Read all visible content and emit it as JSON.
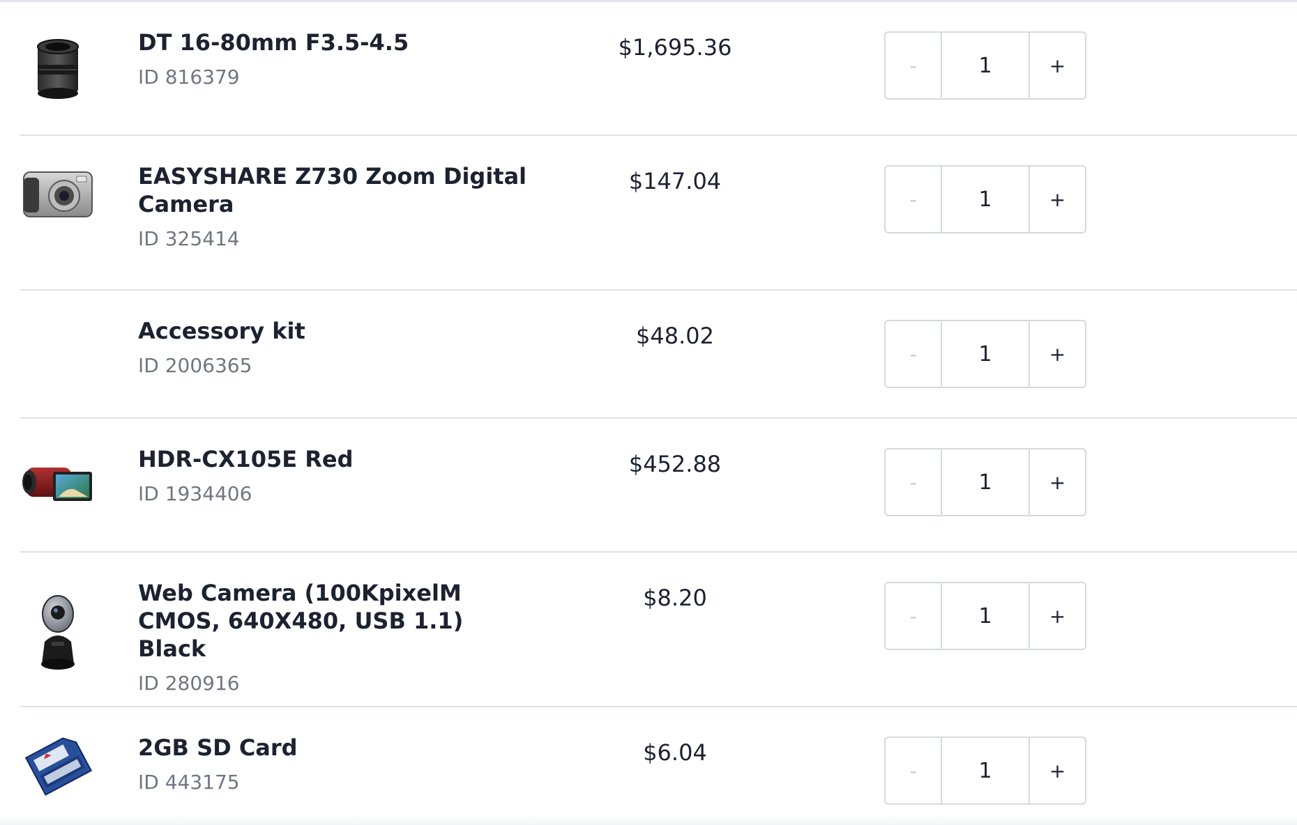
{
  "cart": {
    "items": [
      {
        "name": "DT 16-80mm F3.5-4.5",
        "id_text": "ID 816379",
        "price": "$1,695.36",
        "quantity": "1",
        "decrement_label": "-",
        "increment_label": "+",
        "image_icon": "camera-lens-icon"
      },
      {
        "name": "EASYSHARE Z730 Zoom Digital Camera",
        "id_text": "ID 325414",
        "price": "$147.04",
        "quantity": "1",
        "decrement_label": "-",
        "increment_label": "+",
        "image_icon": "digital-camera-icon"
      },
      {
        "name": "Accessory kit",
        "id_text": "ID 2006365",
        "price": "$48.02",
        "quantity": "1",
        "decrement_label": "-",
        "increment_label": "+",
        "image_icon": ""
      },
      {
        "name": "HDR-CX105E Red",
        "id_text": "ID 1934406",
        "price": "$452.88",
        "quantity": "1",
        "decrement_label": "-",
        "increment_label": "+",
        "image_icon": "camcorder-icon"
      },
      {
        "name": "Web Camera (100KpixelM CMOS, 640X480, USB 1.1) Black",
        "id_text": "ID 280916",
        "price": "$8.20",
        "quantity": "1",
        "decrement_label": "-",
        "increment_label": "+",
        "image_icon": "webcam-icon"
      },
      {
        "name": "2GB SD Card",
        "id_text": "ID 443175",
        "price": "$6.04",
        "quantity": "1",
        "decrement_label": "-",
        "increment_label": "+",
        "image_icon": "sd-card-icon"
      }
    ]
  },
  "colors": {
    "text_primary": "#1d2231",
    "text_secondary": "#727680",
    "divider": "#dfe2e6",
    "stepper_border": "#d6d9de",
    "disabled_minus": "#c5c9cf"
  }
}
